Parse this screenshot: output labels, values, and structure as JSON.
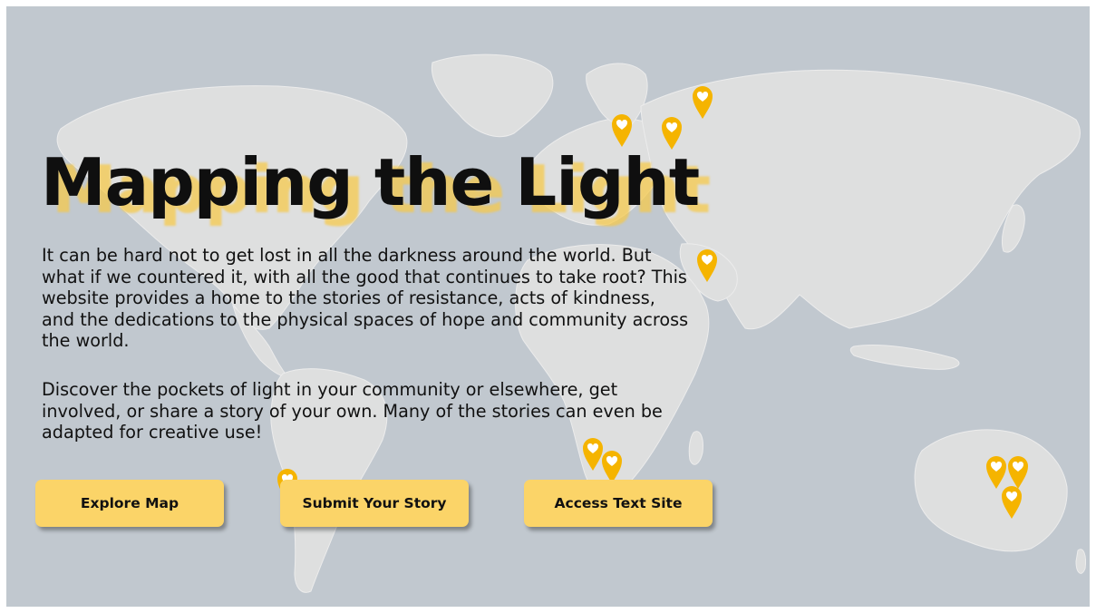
{
  "hero": {
    "title": "Mapping the Light",
    "paragraph_1": "It can be hard not to get lost in all the darkness around the world. But what if we countered it, with all the good that continues to take root? This website provides a home to the stories of resistance, acts of kindness, and the dedications to the physical spaces of hope and community across the world.",
    "paragraph_2": "Discover the pockets of light in your community or elsewhere, get involved, or share a story of your own. Many of the stories can even be adapted for creative use!"
  },
  "buttons": {
    "explore": "Explore Map",
    "submit": "Submit Your Story",
    "text_site": "Access Text Site"
  },
  "map": {
    "pin_icon": "heart-map-pin-icon",
    "pin_color": "#f5b400",
    "ocean_color": "#c1c8cf",
    "land_color": "#dedfdf",
    "accent_color": "#fbd468"
  }
}
